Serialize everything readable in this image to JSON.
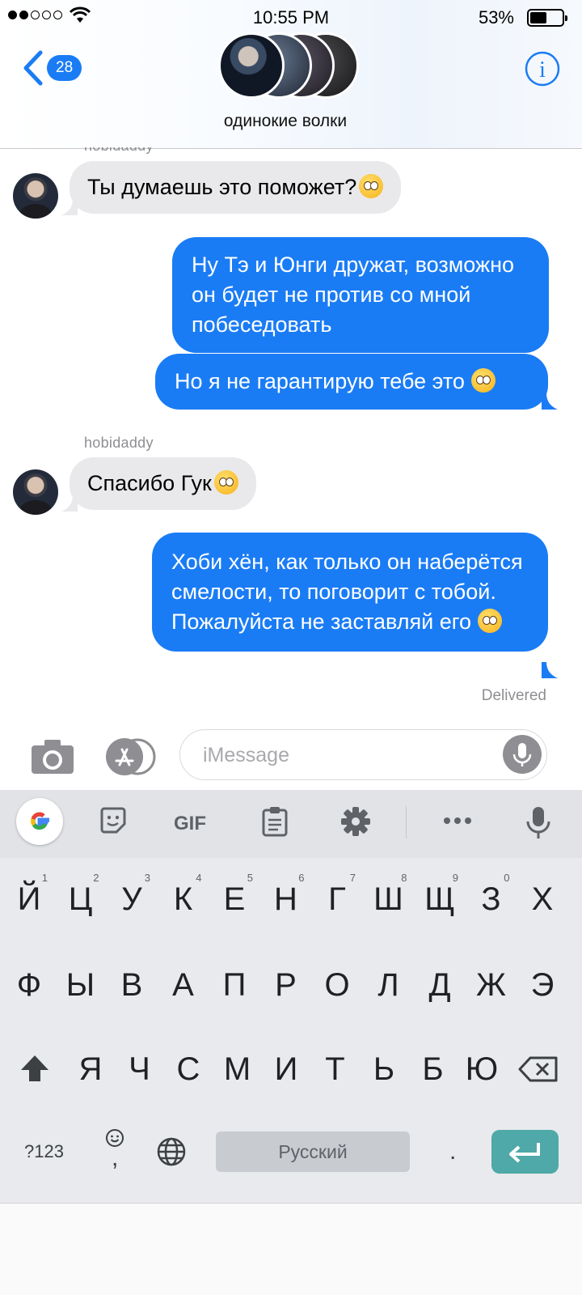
{
  "status_bar": {
    "time": "10:55 PM",
    "battery": "53%",
    "battery_level": 0.53
  },
  "header": {
    "back_count": "28",
    "group_name": "одинокие волки"
  },
  "messages": [
    {
      "id": "m1",
      "direction": "incoming",
      "sender": "hobidaddy",
      "text": "Ты думаешь это поможет?"
    },
    {
      "id": "m2",
      "direction": "outgoing",
      "text": "Ну Тэ и Юнги дружат, возможно он будет не против со мной побеседовать"
    },
    {
      "id": "m3",
      "direction": "outgoing",
      "text": "Но я не гарантирую тебе это"
    },
    {
      "id": "m4",
      "direction": "incoming",
      "sender": "hobidaddy",
      "text": "Спасибо Гук"
    },
    {
      "id": "m5",
      "direction": "outgoing",
      "text": "Хоби хён, как только он наберётся смелости, то поговорит с тобой. Пожалуйста не заставляй его"
    }
  ],
  "delivered_label": "Delivered",
  "compose": {
    "placeholder": "iMessage"
  },
  "keyboard": {
    "toolbar": {
      "gif_label": "GIF"
    },
    "row1": [
      "Й",
      "Ц",
      "У",
      "К",
      "Е",
      "Н",
      "Г",
      "Ш",
      "Щ",
      "З",
      "Х"
    ],
    "row1_hints": [
      "1",
      "2",
      "3",
      "4",
      "5",
      "6",
      "7",
      "8",
      "9",
      "0"
    ],
    "row2": [
      "Ф",
      "Ы",
      "В",
      "А",
      "П",
      "Р",
      "О",
      "Л",
      "Д",
      "Ж",
      "Э"
    ],
    "row3": [
      "Я",
      "Ч",
      "С",
      "М",
      "И",
      "Т",
      "Ь",
      "Б",
      "Ю"
    ],
    "symbols_label": "?123",
    "comma": ",",
    "period": ".",
    "space_label": "Русский"
  },
  "colors": {
    "accent": "#1a7cf5",
    "incoming_bubble": "#e9e9eb",
    "enter_key": "#4fa9a8"
  }
}
